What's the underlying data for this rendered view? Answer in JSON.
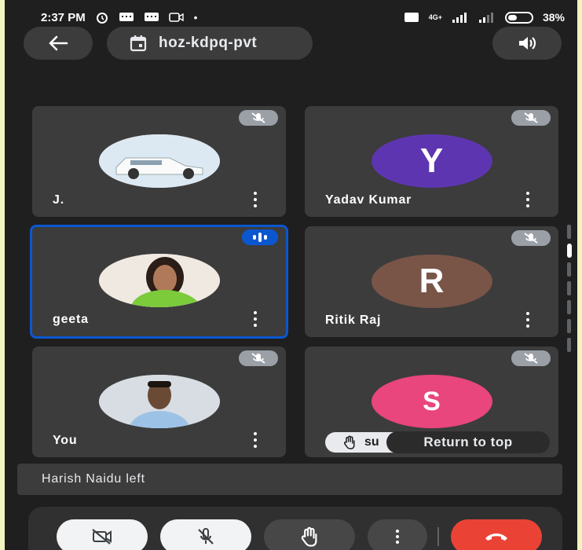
{
  "status_bar": {
    "time": "2:37 PM",
    "network": "4G+",
    "battery": "38%"
  },
  "top_bar": {
    "meeting_code": "hoz-kdpq-pvt"
  },
  "tiles": [
    {
      "name": "J.",
      "avatar_type": "photo",
      "muted": true
    },
    {
      "name": "Yadav Kumar",
      "avatar_letter": "Y",
      "avatar_color": "#5e35b1",
      "muted": true
    },
    {
      "name": "geeta",
      "avatar_type": "photo",
      "speaking": true
    },
    {
      "name": "Ritik Raj",
      "avatar_letter": "R",
      "avatar_color": "#795548",
      "muted": true
    },
    {
      "name": "You",
      "avatar_type": "photo",
      "muted": true
    },
    {
      "avatar_letter": "S",
      "avatar_color": "#e8467c",
      "muted": true
    }
  ],
  "raised_hand": {
    "name_partial": "su"
  },
  "return_to_top": "Return to top",
  "notification": "Harish Naidu left",
  "controls": {
    "camera": "camera-off-icon",
    "mic": "mic-off-icon",
    "hand": "raise-hand-icon",
    "more": "more-vert-icon",
    "end": "end-call-icon"
  },
  "colors": {
    "background": "#1f1f1f",
    "tile": "#3c3c3c",
    "active_border": "#0b57d0",
    "end_call": "#ea4335"
  }
}
